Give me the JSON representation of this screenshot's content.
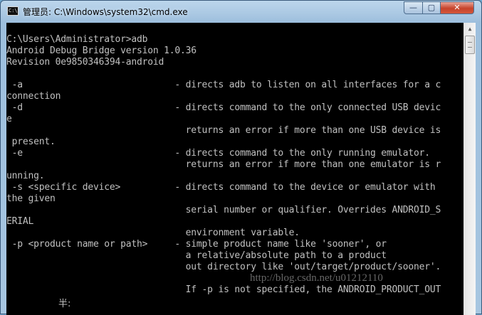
{
  "window": {
    "title": "管理员: C:\\Windows\\system32\\cmd.exe",
    "icon": "cmd-icon",
    "icon_glyph": "C:\\",
    "controls": {
      "minimize_glyph": "—",
      "maximize_glyph": "▢",
      "close_glyph": "✕"
    }
  },
  "console": {
    "lines": [
      "",
      "C:\\Users\\Administrator>adb",
      "Android Debug Bridge version 1.0.36",
      "Revision 0e9850346394-android",
      "",
      " -a                            - directs adb to listen on all interfaces for a c",
      "connection",
      " -d                            - directs command to the only connected USB devic",
      "e",
      "                                 returns an error if more than one USB device is",
      " present.",
      " -e                            - directs command to the only running emulator.",
      "                                 returns an error if more than one emulator is r",
      "unning.",
      " -s <specific device>          - directs command to the device or emulator with",
      "the given",
      "                                 serial number or qualifier. Overrides ANDROID_S",
      "ERIAL",
      "                                 environment variable.",
      " -p <product name or path>     - simple product name like 'sooner', or",
      "                                 a relative/absolute path to a product",
      "                                 out directory like 'out/target/product/sooner'.",
      "",
      "                                 If -p is not specified, the ANDROID_PRODUCT_OUT"
    ]
  },
  "ime_status": "半:",
  "watermark": "http://blog.csdn.net/u01212110",
  "colors": {
    "console_bg": "#000000",
    "console_fg": "#c0c0c0",
    "close_button": "#c6432b",
    "frame": "#a9c7e2"
  }
}
